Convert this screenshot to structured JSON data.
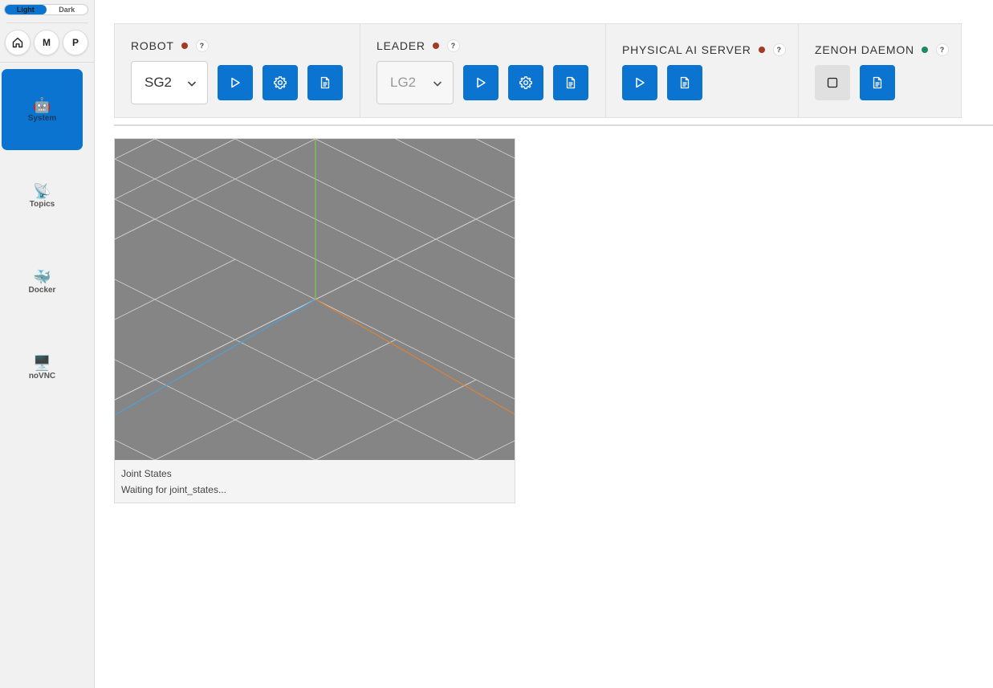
{
  "sidebar": {
    "theme": {
      "light_label": "Light",
      "dark_label": "Dark",
      "selected": "Light"
    },
    "quick_buttons": [
      {
        "label": "",
        "icon": "home-icon"
      },
      {
        "label": "M"
      },
      {
        "label": "P"
      }
    ],
    "nav": [
      {
        "label": "System",
        "icon": "🤖",
        "active": true
      },
      {
        "label": "Topics",
        "icon": "📡",
        "active": false
      },
      {
        "label": "Docker",
        "icon": "🐳",
        "active": false
      },
      {
        "label": "noVNC",
        "icon": "🖥️",
        "active": false
      }
    ]
  },
  "panels": {
    "robot": {
      "title": "ROBOT",
      "status_color": "#a33a22",
      "help": "?",
      "selected": "SG2",
      "buttons": [
        "play-icon",
        "gear-icon",
        "document-icon"
      ]
    },
    "leader": {
      "title": "LEADER",
      "status_color": "#a33a22",
      "help": "?",
      "selected": "LG2",
      "disabled": true,
      "buttons": [
        "play-icon",
        "gear-icon",
        "document-icon"
      ]
    },
    "physical_ai_server": {
      "title": "PHYSICAL AI SERVER",
      "status_color": "#a33a22",
      "help": "?",
      "buttons": [
        "play-icon",
        "document-icon"
      ]
    },
    "zenoh_daemon": {
      "title": "ZENOH DAEMON",
      "status_color": "#1e8a5e",
      "help": "?",
      "buttons": [
        "stop-icon",
        "document-icon"
      ]
    }
  },
  "viewer": {
    "title": "Joint States",
    "status": "Waiting for joint_states..."
  },
  "colors": {
    "accent": "#0b74d1",
    "status_off": "#a33a22",
    "status_on": "#1e8a5e"
  }
}
